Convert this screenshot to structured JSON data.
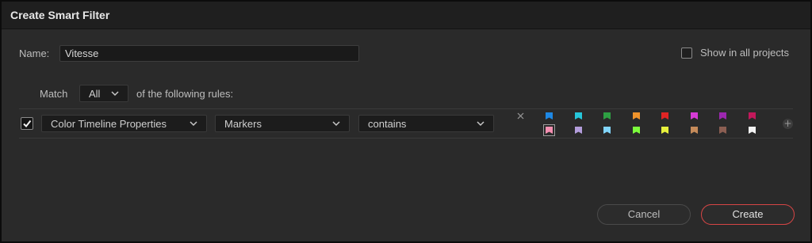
{
  "dialog": {
    "title": "Create Smart Filter",
    "name_label": "Name:",
    "name_value": "Vitesse",
    "show_all_label": "Show in all projects",
    "show_all_checked": false,
    "match_label": "Match",
    "match_value": "All",
    "match_suffix": "of the following rules:"
  },
  "rule": {
    "enabled": true,
    "field": "Color Timeline Properties",
    "property": "Markers",
    "operator": "contains",
    "marker_colors_row1": [
      "#1e88e5",
      "#26c6da",
      "#2ea043",
      "#f0932b",
      "#e02424",
      "#d63bd6",
      "#9c27b0",
      "#c2185b"
    ],
    "marker_colors_row2": [
      "#f48fb1",
      "#b39ddb",
      "#81d4fa",
      "#7cfc3c",
      "#e6f03c",
      "#c58b5a",
      "#8b5e52",
      "#f2f2f2"
    ],
    "selected_marker": "row2-0",
    "remove_icon": "close-icon",
    "add_icon": "plus-icon"
  },
  "buttons": {
    "cancel": "Cancel",
    "create": "Create"
  },
  "colors": {
    "accent": "#d64545",
    "background": "#2a2a2a",
    "titlebar": "#1f1f1f"
  }
}
